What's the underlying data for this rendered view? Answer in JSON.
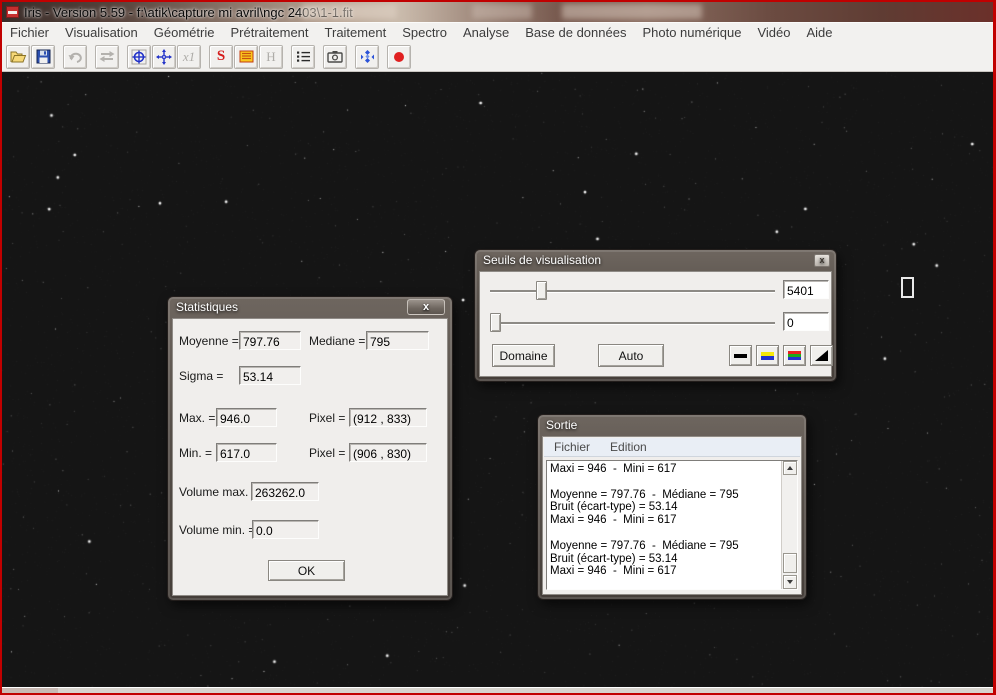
{
  "titlebar": {
    "title": "Iris - Version 5.59 - f:\\atik\\capture mi avril\\ngc 2403\\1-1.fit"
  },
  "menubar": {
    "items": [
      "Fichier",
      "Visualisation",
      "Géométrie",
      "Prétraitement",
      "Traitement",
      "Spectro",
      "Analyse",
      "Base de données",
      "Photo numérique",
      "Vidéo",
      "Aide"
    ]
  },
  "toolbar": {
    "x1_label": "x1",
    "s_label": "S",
    "h_label": "H"
  },
  "stats": {
    "title": "Statistiques",
    "close_label": "x",
    "mean_label": "Moyenne =",
    "mean": "797.76",
    "median_label": "Mediane =",
    "median": "795",
    "sigma_label": "Sigma =",
    "sigma": "53.14",
    "max_label": "Max. =",
    "max": "946.0",
    "max_pixel_label": "Pixel =",
    "max_pixel": "(912 , 833)",
    "min_label": "Min. =",
    "min": "617.0",
    "min_pixel_label": "Pixel =",
    "min_pixel": "(906 , 830)",
    "volume_max_label": "Volume max. =",
    "volume_max": "263262.0",
    "volume_min_label": "Volume min. =",
    "volume_min": "0.0",
    "ok_label": "OK"
  },
  "thresholds": {
    "title": "Seuils de visualisation",
    "close_label": "x",
    "high_value": "5401",
    "low_value": "0",
    "domain_label": "Domaine",
    "auto_label": "Auto"
  },
  "output": {
    "title": "Sortie",
    "menu_file": "Fichier",
    "menu_edit": "Edition",
    "lines": [
      "Maxi = 946  -  Mini = 617",
      "",
      "Moyenne = 797.76  -  Médiane = 795",
      "Bruit (écart-type) = 53.14",
      "Maxi = 946  -  Mini = 617",
      "",
      "Moyenne = 797.76  -  Médiane = 795",
      "Bruit (écart-type) = 53.14",
      "Maxi = 946  -  Mini = 617"
    ]
  },
  "colors": {
    "frame_red": "#c10000",
    "dialog_glass": "#554e48",
    "client_bg": "#f0eeec",
    "accent_blue": "#2232c8",
    "record_red": "#e02020"
  }
}
